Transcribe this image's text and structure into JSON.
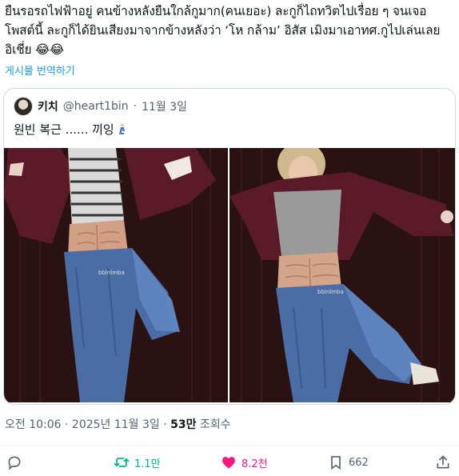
{
  "tweet": {
    "text": "ยืนรอรถไฟฟ้าอยู่ คนข้างหลังยืนใกล้กูมาก(คนเยอะ) ละกูก็ไถทวิตไปเรื่อย ๆ จนเจอโพสต์นี้ ละกูก็ได้ยินเสียงมาจากข้างหลังว่า ‘โห กล้าม’ อิสัส เมิงมาเอาทศ.กูไปเล่นเลยอิเชี่ย 😂😂",
    "translate_label": "게시물 번역하기"
  },
  "quote": {
    "name": "키치",
    "handle": "@heart1bin",
    "separator": "·",
    "date": "11월 3일",
    "text": "원빈 복근 ...... 끼잉",
    "photo_watermark_left": "bblnlmba",
    "photo_watermark_right": "bblnlmba"
  },
  "meta": {
    "timestamp": "오전 10:06 · 2025년 11월 3일 · ",
    "views_count": "53만",
    "views_label": " 조회수"
  },
  "actions": {
    "retweets": "1.1만",
    "likes": "8.2천",
    "bookmarks": "662"
  },
  "colors": {
    "link": "#1d9bf0",
    "retweet": "#00ba7c",
    "like": "#f91880",
    "muted": "#536471"
  },
  "icons": [
    "reply-icon",
    "retweet-icon",
    "like-icon",
    "bookmark-icon",
    "share-icon",
    "avatar",
    "kneeling-person-icon"
  ]
}
